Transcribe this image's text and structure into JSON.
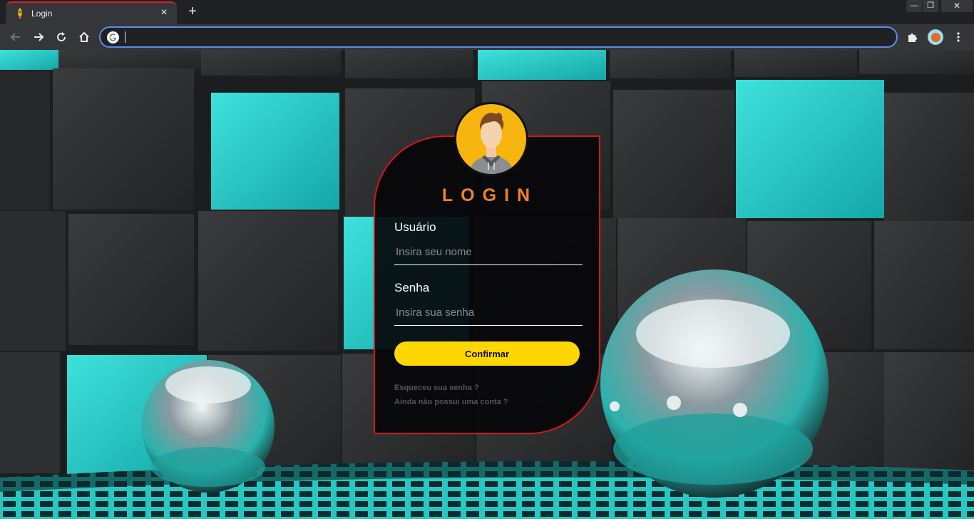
{
  "browser": {
    "tab_title": "Login",
    "tab_close": "×",
    "new_tab": "+",
    "window_controls": {
      "minimize": "—",
      "maximize": "❐",
      "close": "✕"
    },
    "address_value": "",
    "icons": [
      "back-icon",
      "forward-icon",
      "reload-icon",
      "home-icon",
      "google-icon",
      "extensions-icon",
      "profile-avatar-icon",
      "menu-icon"
    ]
  },
  "login": {
    "title": "LOGIN",
    "username_label": "Usuário",
    "username_placeholder": "Insira seu nome",
    "password_label": "Senha",
    "password_placeholder": "Insira sua senha",
    "confirm_button": "Confirmar",
    "forgot_link": "Esqueceu sua senha ?",
    "register_link": "Ainda não possui uma conta ?"
  },
  "colors": {
    "card_border": "#d11818",
    "title": "#f0821e",
    "button": "#ffd700",
    "avatar_bg": "#f6b60f",
    "accent_cyan": "#20c7c3"
  }
}
